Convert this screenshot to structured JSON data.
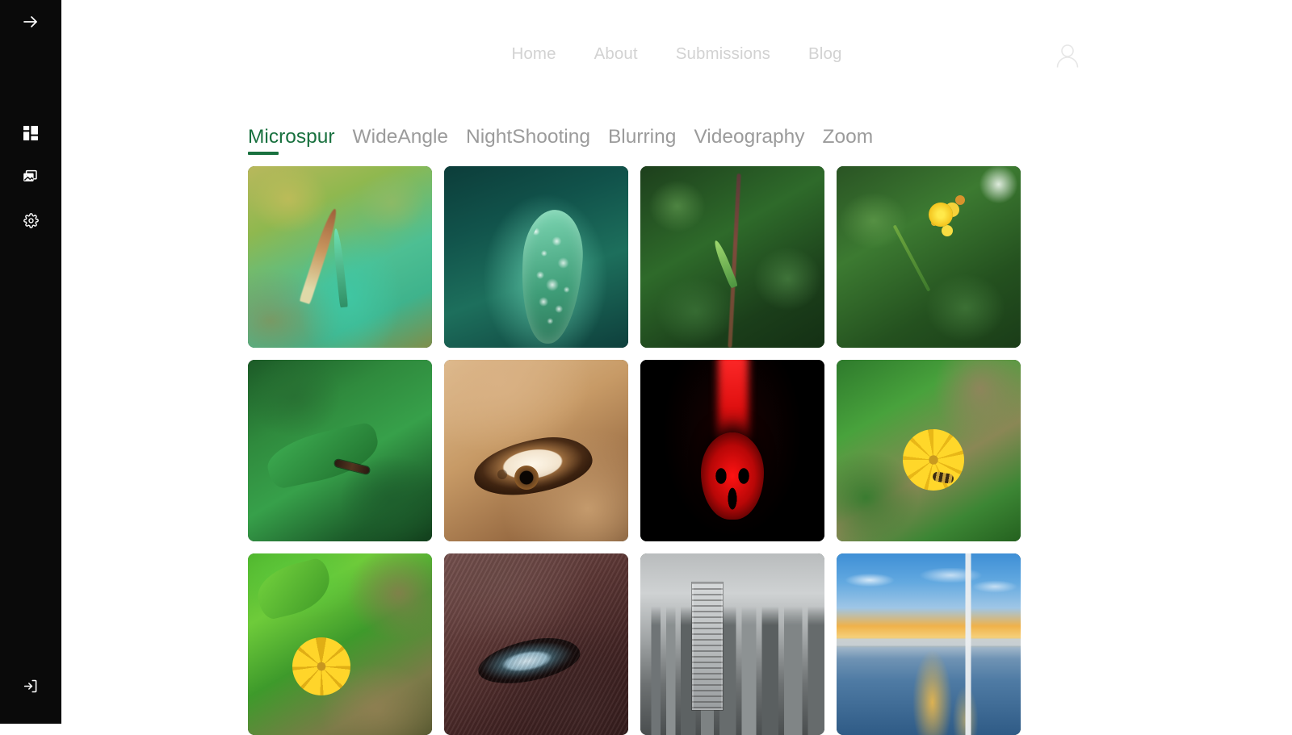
{
  "sidebar": {
    "collapse_toggle": {
      "icon": "arrow-right-icon",
      "label": "Expand sidebar"
    },
    "items": [
      {
        "id": "dashboard",
        "icon": "grid-dashboard-icon",
        "label": "Dashboard"
      },
      {
        "id": "gallery",
        "icon": "photos-stack-icon",
        "label": "Gallery"
      },
      {
        "id": "settings",
        "icon": "gear-icon",
        "label": "Settings"
      }
    ],
    "footer": {
      "id": "login",
      "icon": "login-arrow-icon",
      "label": "Log in"
    },
    "background_color": "#0a0a0a"
  },
  "header": {
    "nav_links": [
      {
        "label": "Home",
        "active": false
      },
      {
        "label": "About",
        "active": false
      },
      {
        "label": "Submissions",
        "active": false
      },
      {
        "label": "Blog",
        "active": false
      }
    ],
    "nav_link_color": "#d2d2d2",
    "account": {
      "icon": "user-avatar-icon",
      "label": "Account"
    }
  },
  "categories": {
    "accent_color": "#19713f",
    "inactive_color": "#9b9b9b",
    "tabs": [
      {
        "label": "Microspur",
        "active": true
      },
      {
        "label": "WideAngle",
        "active": false
      },
      {
        "label": "NightShooting",
        "active": false
      },
      {
        "label": "Blurring",
        "active": false
      },
      {
        "label": "Videography",
        "active": false
      },
      {
        "label": "Zoom",
        "active": false
      }
    ]
  },
  "gallery": {
    "columns": 4,
    "photos": [
      {
        "id": "photo-1",
        "alt": "Blurred macro of a green grass sprout with brown seed husk",
        "art": "art-leafsprout"
      },
      {
        "id": "photo-2",
        "alt": "Teal leaf covered in water droplets on dark background",
        "art": "art-dewleaf"
      },
      {
        "id": "photo-3",
        "alt": "Thin plant stem with new shoot against dark green bokeh",
        "art": "art-stem"
      },
      {
        "id": "photo-4",
        "alt": "Yellow flower buds on a branch with green bokeh",
        "art": "art-yellowbud"
      },
      {
        "id": "photo-5",
        "alt": "Dark caterpillar crawling on a green leaf",
        "art": "art-caterpillar"
      },
      {
        "id": "photo-6",
        "alt": "Extreme close-up of a brown human eye, warm skin tone",
        "art": "art-eye-warm"
      },
      {
        "id": "photo-7",
        "alt": "Backlit red flower on black background",
        "art": "art-redflower"
      },
      {
        "id": "photo-8",
        "alt": "Bee resting on a yellow daisy surrounded by leaves",
        "art": "art-daisybee"
      },
      {
        "id": "photo-9",
        "alt": "Yellow daisy among bright green foliage",
        "art": "art-greendaisy"
      },
      {
        "id": "photo-10",
        "alt": "Close-up of an elderly person's eye with wrinkled skin",
        "art": "art-eye-elder"
      },
      {
        "id": "photo-11",
        "alt": "Black and white city skyline with high-rise towers",
        "art": "art-city"
      },
      {
        "id": "photo-12",
        "alt": "Cable-stayed bridge over water at golden hour",
        "art": "art-bridge"
      }
    ]
  }
}
